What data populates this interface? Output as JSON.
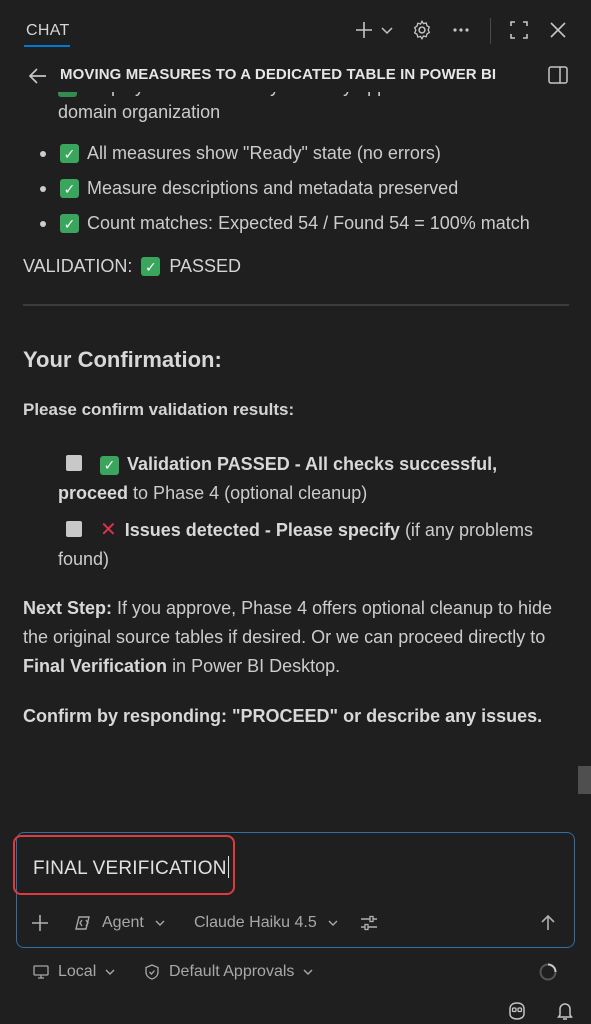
{
  "topbar": {
    "tab_label": "CHAT",
    "icons": [
      "plus-icon",
      "chevron-down-icon",
      "gear-icon",
      "more-icon",
      "maximize-icon",
      "close-icon"
    ]
  },
  "header": {
    "title": "MOVING MEASURES TO A DEDICATED TABLE IN POWER BI"
  },
  "message": {
    "partial_line_1": "Display Folder hierarchy correctly applied with business",
    "partial_line_2": "domain organization",
    "bullets": [
      "All measures show \"Ready\" state (no errors)",
      "Measure descriptions and metadata preserved",
      "Count matches: Expected 54 / Found 54 = 100% match"
    ],
    "validation_label": "VALIDATION:",
    "validation_result": "PASSED",
    "confirmation_heading": "Your Confirmation:",
    "please_confirm": "Please confirm validation results:",
    "option1_bold": "Validation PASSED - All checks successful, proceed",
    "option1_rest": "to Phase 4 (optional cleanup)",
    "option2_bold": "Issues detected - Please specify",
    "option2_rest": "(if any problems found)",
    "next_step_label": "Next Step:",
    "next_step_text_1": "If you approve, Phase 4 offers optional cleanup to hide the original source tables if desired. Or we can proceed directly to",
    "next_step_bold": "Final Verification",
    "next_step_text_2": "in Power BI Desktop.",
    "confirm_line": "Confirm by responding: \"PROCEED\" or describe any issues."
  },
  "input": {
    "value": "FINAL VERIFICATION",
    "mode_label": "Agent",
    "model_label": "Claude Haiku 4.5"
  },
  "footer": {
    "location_label": "Local",
    "approvals_label": "Default Approvals"
  },
  "colors": {
    "background": "#1f1f1f",
    "accent": "#0078d4",
    "check_green": "#3aa55d",
    "error_red": "#e0314c",
    "highlight_red": "#e0393e"
  }
}
